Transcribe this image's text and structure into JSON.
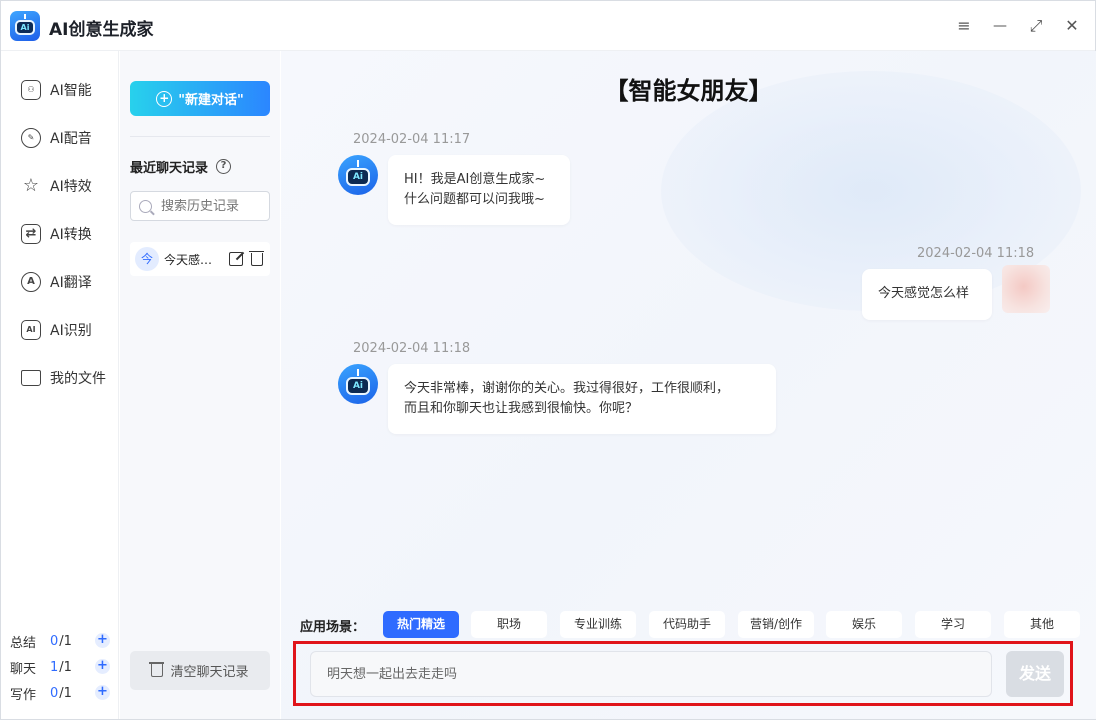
{
  "app": {
    "title": "AI创意生成家",
    "logo_text": "Ai"
  },
  "window_controls": {
    "menu": "≡",
    "minimize": "—",
    "maximize": "⤢",
    "close": "✕"
  },
  "nav": {
    "items": [
      {
        "label": "AI智能",
        "icon": "robot-icon",
        "glyph": "⚇"
      },
      {
        "label": "AI配音",
        "icon": "microphone-icon",
        "glyph": "✎"
      },
      {
        "label": "AI特效",
        "icon": "sparkle-icon",
        "glyph": "☆"
      },
      {
        "label": "AI转换",
        "icon": "convert-icon",
        "glyph": "⇄"
      },
      {
        "label": "AI翻译",
        "icon": "translate-icon",
        "glyph": "A"
      },
      {
        "label": "AI识别",
        "icon": "recognize-icon",
        "glyph": "AI"
      },
      {
        "label": "我的文件",
        "icon": "folder-icon",
        "glyph": ""
      }
    ],
    "quotas": [
      {
        "label": "总结",
        "used": "0",
        "total": "/1"
      },
      {
        "label": "聊天",
        "used": "1",
        "total": "/1"
      },
      {
        "label": "写作",
        "used": "0",
        "total": "/1"
      }
    ]
  },
  "history": {
    "new_chat_label": "\"新建对话\"",
    "recent_title": "最近聊天记录",
    "search_placeholder": "搜索历史记录",
    "items": [
      {
        "avatar": "今",
        "text": "今天感觉怎么样"
      }
    ],
    "clear_label": "清空聊天记录"
  },
  "chat": {
    "title": "【智能女朋友】",
    "messages": [
      {
        "role": "bot",
        "time": "2024-02-04 11:17",
        "lines": [
          "HI！我是AI创意生成家~",
          "什么问题都可以问我哦~"
        ]
      },
      {
        "role": "user",
        "time": "2024-02-04 11:18",
        "lines": [
          "今天感觉怎么样"
        ]
      },
      {
        "role": "bot",
        "time": "2024-02-04 11:18",
        "lines": [
          "今天非常棒，谢谢你的关心。我过得很好，工作很顺利，",
          "而且和你聊天也让我感到很愉快。你呢？"
        ]
      }
    ]
  },
  "scenes": {
    "label": "应用场景：",
    "tabs": [
      "热门精选",
      "职场",
      "专业训练",
      "代码助手",
      "营销/创作",
      "娱乐",
      "学习",
      "其他"
    ],
    "active": 0
  },
  "composer": {
    "value": "明天想一起出去走走吗",
    "send_label": "发送"
  },
  "colors": {
    "accent": "#2f6bff",
    "highlight_frame": "#e0141a",
    "new_chat_gradient_start": "#28d1ec",
    "new_chat_gradient_end": "#2b86ff"
  }
}
